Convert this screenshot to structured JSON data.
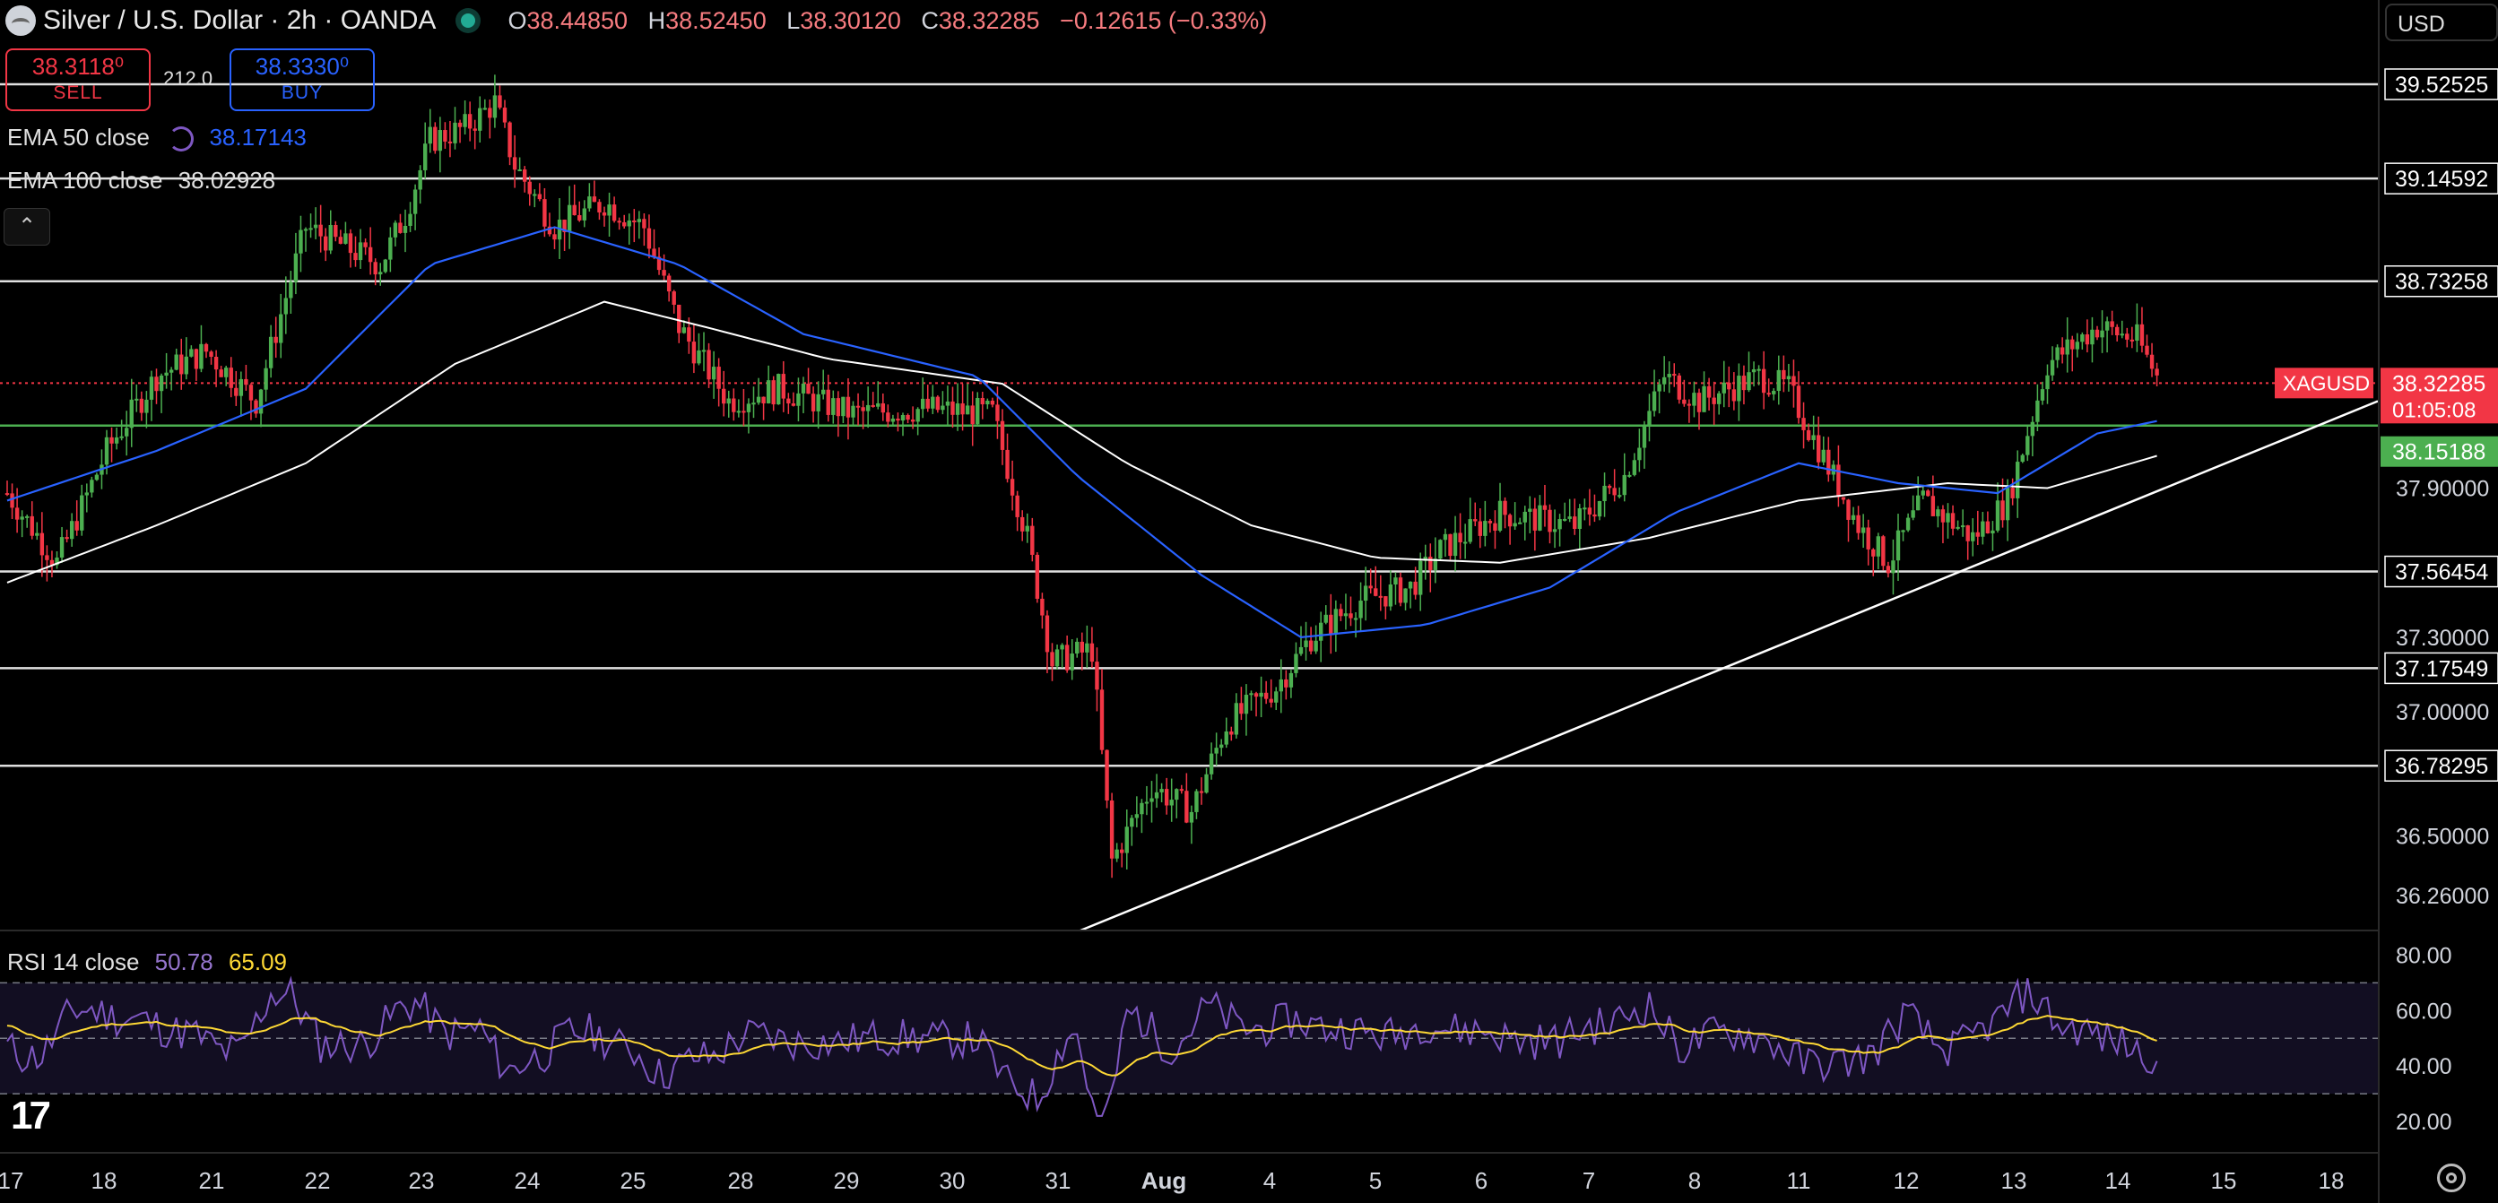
{
  "header": {
    "symbol": "Silver / U.S. Dollar · 2h · OANDA",
    "o_label": "O",
    "o_value": "38.44850",
    "h_label": "H",
    "h_value": "38.52450",
    "l_label": "L",
    "l_value": "38.30120",
    "c_label": "C",
    "c_value": "38.32285",
    "change": "−0.12615 (−0.33%)"
  },
  "trade": {
    "sell_price": "38.3118⁰",
    "sell_label": "SELL",
    "spread": "212.0",
    "buy_price": "38.3330⁰",
    "buy_label": "BUY"
  },
  "indicators": {
    "ema50_label": "EMA 50 close",
    "ema50_value": "38.17143",
    "ema100_label": "EMA 100 close",
    "ema100_value": "38.02928",
    "rsi_label": "RSI 14 close",
    "rsi_value": "50.78",
    "rsi_ma_value": "65.09"
  },
  "currency": "USD",
  "colors": {
    "up": "#4caf50",
    "down": "#f23645",
    "ema50": "#2962ff",
    "ema100": "#ffffff",
    "rsi": "#7e57c2",
    "rsi_ma": "#fdd835",
    "current": "#f23645",
    "green_level": "#4caf50"
  },
  "icons": [
    "tradingview-logo-icon",
    "settings-gear-icon",
    "chevron-up-icon",
    "loading-icon"
  ],
  "chart_data": {
    "type": "candlestick",
    "title": "Silver / U.S. Dollar · 2h · OANDA",
    "ylim": [
      36.12,
      39.72
    ],
    "y_ticks": [
      "37.90000",
      "37.30000",
      "37.00000",
      "36.50000",
      "36.26000"
    ],
    "x_ticks": [
      "17",
      "18",
      "21",
      "22",
      "23",
      "24",
      "25",
      "28",
      "29",
      "30",
      "31",
      "Aug",
      "4",
      "5",
      "6",
      "7",
      "8",
      "11",
      "12",
      "13",
      "14",
      "15",
      "18"
    ],
    "horizontal_levels": [
      "39.52525",
      "39.14592",
      "38.73258",
      "37.56454",
      "37.17549",
      "36.78295"
    ],
    "symbol_tag": "XAGUSD",
    "current_price": "38.32285",
    "countdown": "01:05:08",
    "green_level": "38.15188",
    "trendline": {
      "from": [
        "31",
        36.12
      ],
      "to": [
        "15",
        38.25
      ]
    },
    "close_path": [
      [
        0,
        37.88
      ],
      [
        10,
        37.6
      ],
      [
        20,
        38.05
      ],
      [
        30,
        38.35
      ],
      [
        40,
        38.45
      ],
      [
        50,
        38.25
      ],
      [
        60,
        38.95
      ],
      [
        70,
        38.85
      ],
      [
        75,
        38.8
      ],
      [
        80,
        39.0
      ],
      [
        85,
        39.3
      ],
      [
        92,
        39.35
      ],
      [
        98,
        39.45
      ],
      [
        102,
        39.2
      ],
      [
        110,
        38.95
      ],
      [
        120,
        39.05
      ],
      [
        128,
        38.95
      ],
      [
        135,
        38.55
      ],
      [
        145,
        38.25
      ],
      [
        155,
        38.3
      ],
      [
        170,
        38.2
      ],
      [
        185,
        38.22
      ],
      [
        198,
        38.2
      ],
      [
        205,
        37.7
      ],
      [
        210,
        37.2
      ],
      [
        218,
        37.25
      ],
      [
        222,
        36.4
      ],
      [
        230,
        36.7
      ],
      [
        238,
        36.6
      ],
      [
        245,
        36.95
      ],
      [
        255,
        37.1
      ],
      [
        262,
        37.3
      ],
      [
        272,
        37.45
      ],
      [
        282,
        37.5
      ],
      [
        288,
        37.65
      ],
      [
        300,
        37.8
      ],
      [
        315,
        37.75
      ],
      [
        325,
        37.95
      ],
      [
        333,
        38.35
      ],
      [
        340,
        38.25
      ],
      [
        352,
        38.35
      ],
      [
        358,
        38.3
      ],
      [
        363,
        38.1
      ],
      [
        372,
        37.75
      ],
      [
        378,
        37.6
      ],
      [
        385,
        37.85
      ],
      [
        395,
        37.7
      ],
      [
        402,
        37.85
      ],
      [
        410,
        38.4
      ],
      [
        420,
        38.55
      ],
      [
        428,
        38.5
      ],
      [
        432,
        38.35
      ]
    ],
    "ema50_path": [
      [
        0,
        37.85
      ],
      [
        30,
        38.05
      ],
      [
        60,
        38.3
      ],
      [
        85,
        38.8
      ],
      [
        110,
        38.95
      ],
      [
        135,
        38.8
      ],
      [
        160,
        38.52
      ],
      [
        195,
        38.35
      ],
      [
        215,
        37.95
      ],
      [
        240,
        37.55
      ],
      [
        260,
        37.3
      ],
      [
        285,
        37.35
      ],
      [
        310,
        37.5
      ],
      [
        335,
        37.8
      ],
      [
        360,
        38.0
      ],
      [
        380,
        37.92
      ],
      [
        400,
        37.88
      ],
      [
        420,
        38.12
      ],
      [
        432,
        38.17
      ]
    ],
    "ema100_path": [
      [
        0,
        37.52
      ],
      [
        30,
        37.75
      ],
      [
        60,
        38.0
      ],
      [
        90,
        38.4
      ],
      [
        120,
        38.65
      ],
      [
        140,
        38.55
      ],
      [
        165,
        38.42
      ],
      [
        200,
        38.32
      ],
      [
        225,
        38.0
      ],
      [
        250,
        37.75
      ],
      [
        275,
        37.62
      ],
      [
        300,
        37.6
      ],
      [
        330,
        37.7
      ],
      [
        360,
        37.85
      ],
      [
        390,
        37.92
      ],
      [
        410,
        37.9
      ],
      [
        432,
        38.03
      ]
    ]
  },
  "rsi_panel": {
    "y_ticks": [
      "80.00",
      "60.00",
      "40.00",
      "20.00"
    ],
    "ylim": [
      10,
      85
    ],
    "band": [
      30,
      70
    ]
  }
}
